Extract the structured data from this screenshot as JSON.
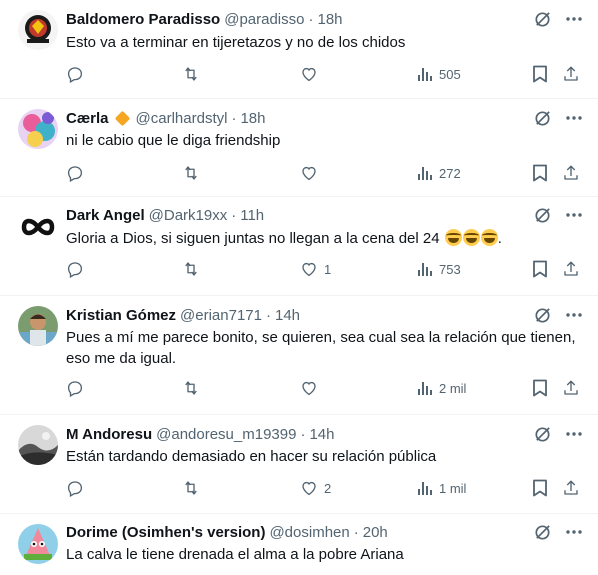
{
  "tweets": [
    {
      "name": "Baldomero Paradisso",
      "handle": "@paradisso",
      "time": "18h",
      "text": "Esto va a terminar en tijeretazos y no de los chidos",
      "replies": "",
      "retweets": "",
      "likes": "",
      "views": "505",
      "verified": false,
      "avatar": "logo-avatar"
    },
    {
      "name": "Cærla",
      "handle": "@carlhardstyl",
      "time": "18h",
      "text": "ni le cabio que le diga friendship",
      "replies": "",
      "retweets": "",
      "likes": "",
      "views": "272",
      "verified": true,
      "avatar": "art-avatar"
    },
    {
      "name": "Dark Angel",
      "handle": "@Dark19xx",
      "time": "11h",
      "text": "Gloria a Dios, si siguen juntas no llegan a la cena del 24 ",
      "text_suffix": ".",
      "emojis": [
        "rolling-on-floor-laughing",
        "rolling-on-floor-laughing",
        "rolling-on-floor-laughing"
      ],
      "replies": "",
      "retweets": "",
      "likes": "1",
      "views": "753",
      "verified": false,
      "avatar": "infinity-avatar"
    },
    {
      "name": "Kristian Gómez",
      "handle": "@erian7171",
      "time": "14h",
      "text": "Pues a mí me parece bonito, se quieren, sea cual sea la relación que tienen, eso me da igual.",
      "replies": "",
      "retweets": "",
      "likes": "",
      "views": "2 mil",
      "verified": false,
      "avatar": "photo-avatar"
    },
    {
      "name": "M Andoresu",
      "handle": "@andoresu_m19399",
      "time": "14h",
      "text": "Están tardando demasiado en hacer su relación pública",
      "replies": "",
      "retweets": "",
      "likes": "2",
      "views": "1 mil",
      "verified": false,
      "avatar": "landscape-avatar"
    },
    {
      "name": "Dorime (Osimhen's version)",
      "handle": "@dosimhen",
      "time": "20h",
      "text": "La calva le tiene drenada el alma a la pobre Ariana",
      "verified": false,
      "avatar": "cartoon-avatar"
    }
  ],
  "separator": "·",
  "colors": {
    "text": "#0f1419",
    "muted": "#536471",
    "divider": "#eff3f4",
    "verified": "#f5a623"
  }
}
